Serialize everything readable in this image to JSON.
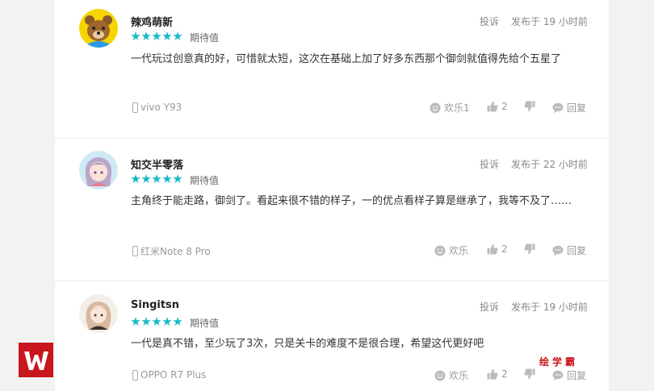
{
  "colors": {
    "accent": "#14b9c8",
    "brand_red": "#c8161d"
  },
  "reviews": [
    {
      "username": "辣鸡萌新",
      "rating_label": "期待值",
      "stars": 5,
      "report": "投诉",
      "time": "发布于 19 小时前",
      "text": "一代玩过创意真的好，可惜就太短，这次在基础上加了好多东西那个御剑就值得先给个五星了",
      "device": "vivo Y93",
      "fun_label": "欢乐1",
      "likes": "2",
      "reply_label": "回复",
      "avatar_icon": "bear-avatar-icon"
    },
    {
      "username": "知交半零落",
      "rating_label": "期待值",
      "stars": 5,
      "report": "投诉",
      "time": "发布于 22 小时前",
      "text": "主角终于能走路，御剑了。看起来很不错的样子，一的优点看样子算是继承了，我等不及了……",
      "device": "红米Note 8 Pro",
      "fun_label": "欢乐",
      "likes": "2",
      "reply_label": "回复",
      "avatar_icon": "anime-girl-avatar-icon"
    },
    {
      "username": "Singitsn",
      "rating_label": "期待值",
      "stars": 5,
      "report": "投诉",
      "time": "发布于 19 小时前",
      "text": "一代是真不错，至少玩了3次，只是关卡的难度不是很合理，希望这代更好吧",
      "device": "OPPO R7 Plus",
      "fun_label": "欢乐",
      "likes": "2",
      "reply_label": "回复",
      "avatar_icon": "anime-character-avatar-icon"
    }
  ],
  "watermark": {
    "text": "绘学霸",
    "logo_icon": "brand-logo-icon"
  }
}
